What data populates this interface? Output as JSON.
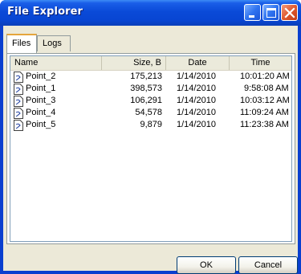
{
  "window": {
    "title": "File Explorer"
  },
  "tabs": [
    {
      "label": "Files"
    },
    {
      "label": "Logs"
    }
  ],
  "columns": [
    "Name",
    "Size, B",
    "Date",
    "Time"
  ],
  "files": [
    {
      "name": "Point_2",
      "size": "175,213",
      "date": "1/14/2010",
      "time": "10:01:20 AM"
    },
    {
      "name": "Point_1",
      "size": "398,573",
      "date": "1/14/2010",
      "time": "9:58:08 AM"
    },
    {
      "name": "Point_3",
      "size": "106,291",
      "date": "1/14/2010",
      "time": "10:03:12 AM"
    },
    {
      "name": "Point_4",
      "size": "54,578",
      "date": "1/14/2010",
      "time": "11:09:24 AM"
    },
    {
      "name": "Point_5",
      "size": "9,879",
      "date": "1/14/2010",
      "time": "11:23:38 AM"
    }
  ],
  "buttons": {
    "ok": "OK",
    "cancel": "Cancel"
  },
  "icons": {
    "minimize": "minimize-icon",
    "maximize": "maximize-icon",
    "close": "close-icon",
    "file": "document-icon"
  }
}
